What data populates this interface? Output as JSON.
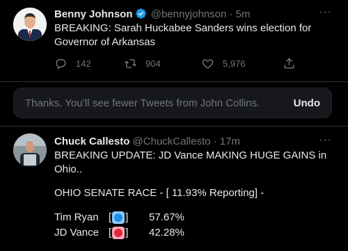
{
  "tweet1": {
    "name": "Benny Johnson",
    "handle": "@bennyjohnson",
    "dot": "·",
    "time": "5m",
    "body": "BREAKING: Sarah Huckabee Sanders wins election for Governor of Arkansas",
    "reply_count": "142",
    "retweet_count": "904",
    "like_count": "5,976"
  },
  "notice": {
    "text": "Thanks. You’ll see fewer Tweets from John Collins.",
    "undo_label": "Undo"
  },
  "tweet2": {
    "name": "Chuck Callesto",
    "handle": "@ChuckCallesto",
    "dot": "·",
    "time": "17m",
    "line1": "BREAKING UPDATE: JD Vance MAKING HUGE GAINS in",
    "line2": "Ohio..",
    "race_header": "OHIO SENATE RACE - [ 11.93% Reporting] -",
    "candidates": [
      {
        "name": "Tim Ryan",
        "open": "[",
        "close": "]",
        "emoji": "blue-circle-icon",
        "percent": "57.67%"
      },
      {
        "name": "JD Vance",
        "open": "[",
        "close": "]",
        "emoji": "red-circle-icon",
        "percent": "42.28%"
      }
    ]
  },
  "more_icon": "more-dots-icon",
  "colors": {
    "background": "#000000",
    "text": "#e7e9ea",
    "muted": "#71767b",
    "verified": "#1d9bf0",
    "divider": "#2f3336"
  }
}
